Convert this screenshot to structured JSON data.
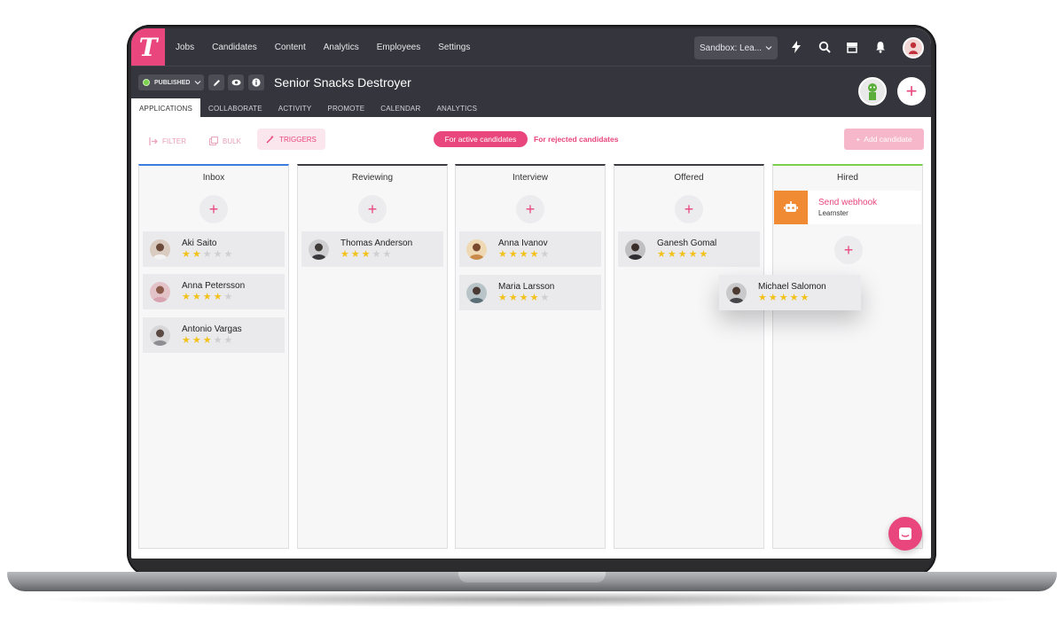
{
  "nav": {
    "logo_letter": "T",
    "items": [
      "Jobs",
      "Candidates",
      "Content",
      "Analytics",
      "Employees",
      "Settings"
    ],
    "sandbox_label": "Sandbox: Lea...",
    "icons": [
      "lightning-icon",
      "search-icon",
      "store-icon",
      "bell-icon"
    ]
  },
  "job": {
    "status": "PUBLISHED",
    "title": "Senior Snacks Destroyer",
    "tabs": [
      "APPLICATIONS",
      "COLLABORATE",
      "ACTIVITY",
      "PROMOTE",
      "CALENDAR",
      "ANALYTICS"
    ],
    "active_tab": "APPLICATIONS"
  },
  "toolbar": {
    "filter": "FILTER",
    "bulk": "BULK",
    "triggers": "TRIGGERS",
    "active_filter": "For active candidates",
    "rejected_filter": "For rejected candidates",
    "add_candidate": "Add candidate"
  },
  "columns": [
    {
      "title": "Inbox",
      "accent": "#3b7ddd"
    },
    {
      "title": "Reviewing",
      "accent": "#3c3d44"
    },
    {
      "title": "Interview",
      "accent": "#3c3d44"
    },
    {
      "title": "Offered",
      "accent": "#3c3d44"
    },
    {
      "title": "Hired",
      "accent": "#7bd04c"
    }
  ],
  "cards": {
    "inbox": [
      {
        "name": "Aki Saito",
        "rating": 2
      },
      {
        "name": "Anna Petersson",
        "rating": 4
      },
      {
        "name": "Antonio Vargas",
        "rating": 3
      }
    ],
    "reviewing": [
      {
        "name": "Thomas Anderson",
        "rating": 3
      }
    ],
    "interview": [
      {
        "name": "Anna Ivanov",
        "rating": 4
      },
      {
        "name": "Maria Larsson",
        "rating": 4
      }
    ],
    "offered": [
      {
        "name": "Ganesh Gomal",
        "rating": 5
      }
    ],
    "dragging": {
      "name": "Michael Salomon",
      "rating": 5
    }
  },
  "hired_trigger": {
    "title": "Send webhook",
    "subtitle": "Learnster"
  },
  "colors": {
    "brand": "#e8467c",
    "dark": "#35363d",
    "star": "#f2c21b"
  }
}
